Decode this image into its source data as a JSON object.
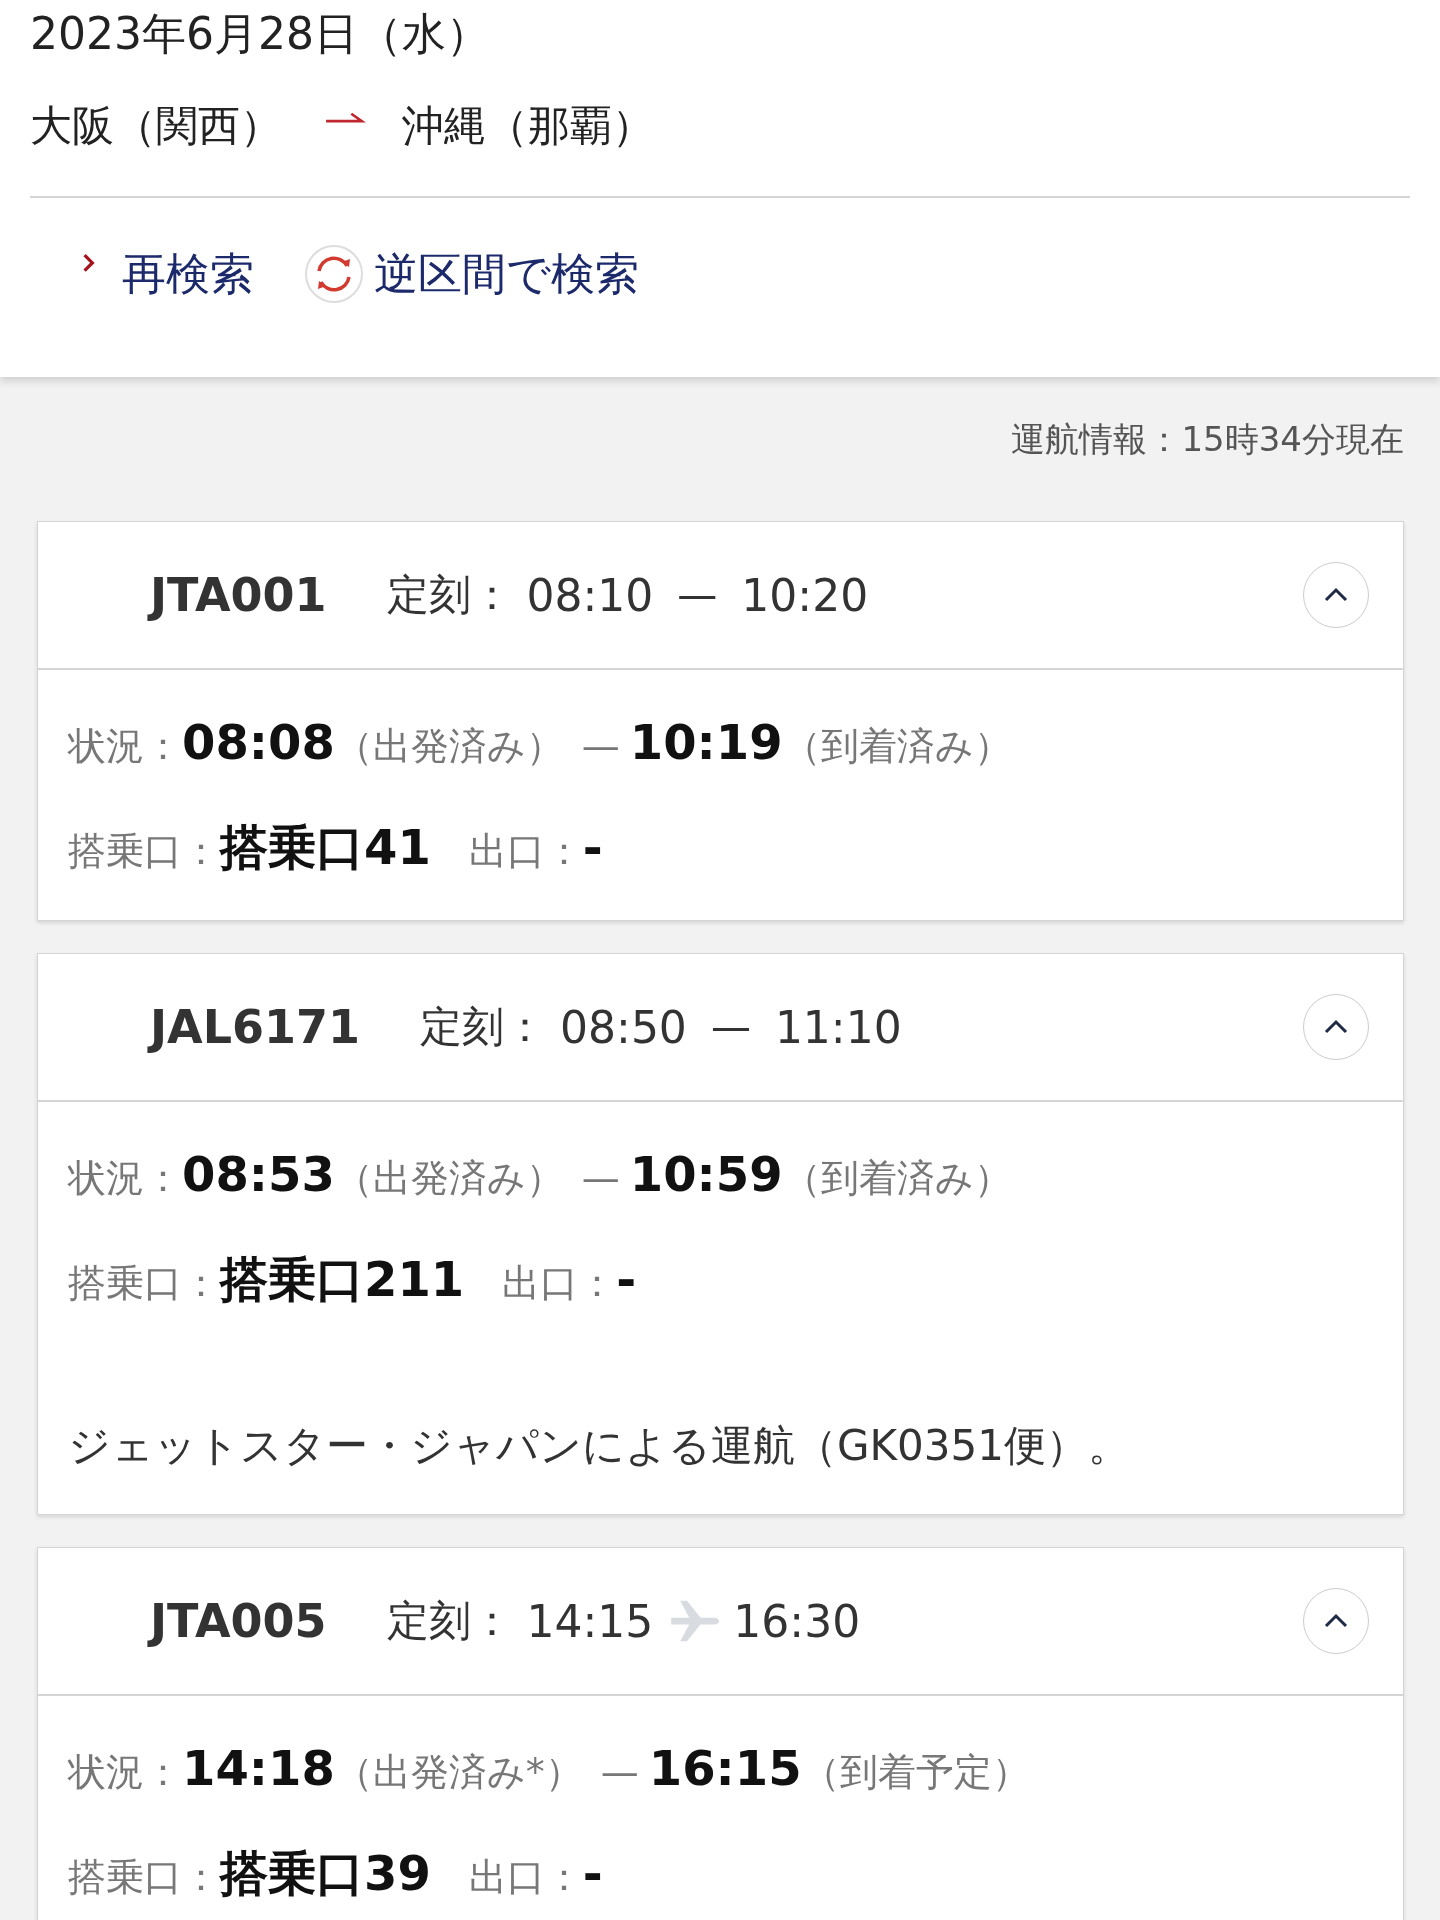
{
  "header": {
    "date": "2023年6月28日（水）",
    "origin": "大阪（関西）",
    "destination": "沖縄（那覇）"
  },
  "links": [
    {
      "kind": "chevron",
      "label": "再検索"
    },
    {
      "kind": "reverse",
      "label": "逆区間で検索"
    }
  ],
  "info": "運航情報：15時34分現在",
  "flights": [
    {
      "number": "JTA001",
      "scheduled_label": "定刻：",
      "departure": "08:10",
      "route_mark": {
        "kind": "dash",
        "text": "—"
      },
      "arrival": "10:20",
      "expanded": true,
      "status_label": "状況：",
      "actual_departure": "08:08",
      "departure_status": "（出発済み）",
      "status_separator": "—",
      "actual_arrival": "10:19",
      "arrival_status": "（到着済み）",
      "gate_label": "搭乗口：",
      "gate": "搭乗口41",
      "exit_label": "出口：",
      "exit": "-"
    },
    {
      "number": "JAL6171",
      "scheduled_label": "定刻：",
      "departure": "08:50",
      "route_mark": {
        "kind": "dash",
        "text": "—"
      },
      "arrival": "11:10",
      "expanded": true,
      "status_label": "状況：",
      "actual_departure": "08:53",
      "departure_status": "（出発済み）",
      "status_separator": "—",
      "actual_arrival": "10:59",
      "arrival_status": "（到着済み）",
      "gate_label": "搭乗口：",
      "gate": "搭乗口211",
      "exit_label": "出口：",
      "exit": "-",
      "note": "ジェットスター・ジャパンによる運航（GK0351便）。"
    },
    {
      "number": "JTA005",
      "scheduled_label": "定刻：",
      "departure": "14:15",
      "route_mark": {
        "kind": "plane"
      },
      "arrival": "16:30",
      "expanded": true,
      "status_label": "状況：",
      "actual_departure": "14:18",
      "departure_status": "（出発済み*）",
      "status_separator": "—",
      "actual_arrival": "16:15",
      "arrival_status": "（到着予定）",
      "gate_label": "搭乗口：",
      "gate": "搭乗口39",
      "exit_label": "出口：",
      "exit": "-"
    }
  ]
}
